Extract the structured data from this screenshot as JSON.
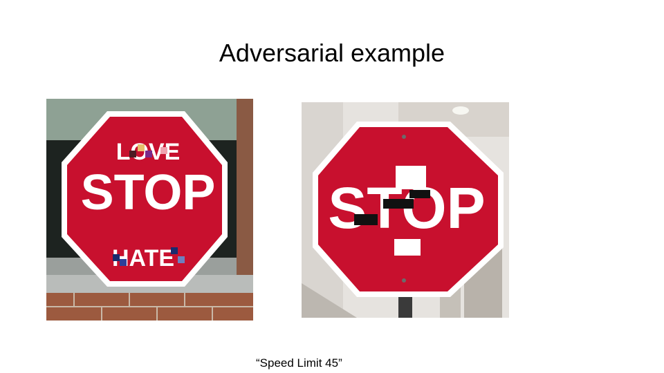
{
  "slide": {
    "title": "Adversarial example",
    "caption": "“Speed Limit 45”"
  },
  "left_photo": {
    "sign_word": "STOP",
    "top_word": "LOVE",
    "bottom_word": "HATE",
    "sign_color": "#c8102e",
    "border_color": "#ffffff"
  },
  "right_photo": {
    "sign_word": "STOP",
    "sign_color": "#c8102e",
    "sticker_black": "#111111",
    "sticker_white": "#ffffff"
  }
}
